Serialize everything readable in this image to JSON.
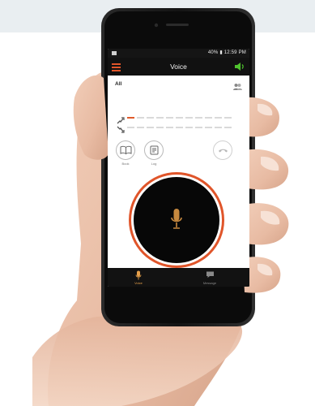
{
  "colors": {
    "accent": "#e0552a",
    "speaker": "#4fc22e",
    "nav_active": "#e7a04a"
  },
  "status_bar": {
    "right_text": "40% ▮ 12:59 PM"
  },
  "app_bar": {
    "title": "Voice",
    "menu_icon": "hamburger-menu-icon",
    "speaker_icon": "speaker-icon"
  },
  "group": {
    "label": "All",
    "contacts_icon": "contacts-icon"
  },
  "controls": {
    "book": {
      "label": "Book",
      "icon": "book-icon"
    },
    "log": {
      "label": "Log",
      "icon": "log-icon"
    },
    "hangup": {
      "icon": "hang-up-icon"
    }
  },
  "ptt": {
    "icon": "microphone-icon"
  },
  "bottom_nav": [
    {
      "label": "Voice",
      "icon": "microphone-icon",
      "active": true
    },
    {
      "label": "Message",
      "icon": "message-bubble-icon",
      "active": false
    }
  ]
}
